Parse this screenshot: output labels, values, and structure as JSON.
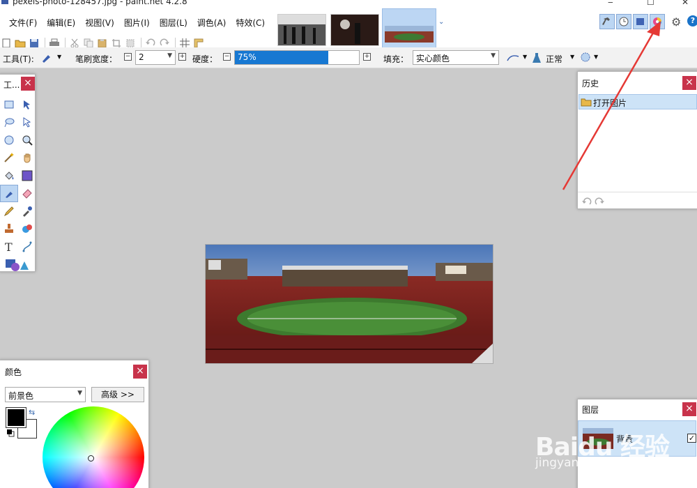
{
  "window": {
    "title": "pexels-photo-128457.jpg - paint.net 4.2.8"
  },
  "menu": [
    "文件(F)",
    "编辑(E)",
    "视图(V)",
    "图片(I)",
    "图层(L)",
    "调色(A)",
    "特效(C)"
  ],
  "toolbar": {
    "tool_label": "工具(T):",
    "brush_width_label": "笔刷宽度：",
    "brush_width_value": "2",
    "hardness_label": "硬度：",
    "hardness_value": "75%",
    "hardness_fraction": 0.75,
    "fill_label": "填充：",
    "fill_value": "实心颜色",
    "blend_mode": "正常"
  },
  "tools_panel": {
    "title": "工...",
    "close": "×"
  },
  "history_panel": {
    "title": "历史",
    "close": "×",
    "items": [
      "打开图片"
    ]
  },
  "colors_panel": {
    "title": "颜色",
    "close": "×",
    "mode_select": "前景色",
    "advanced_button": "高级 >>"
  },
  "layers_panel": {
    "title": "图层",
    "close": "×",
    "layer_name": "背景"
  },
  "watermark": {
    "main": "Baidu 经验",
    "sub": "jingyan.baidu.com"
  },
  "colors": {
    "accent": "#1778d2",
    "close_red": "#c8334b",
    "selection": "#cde3f7",
    "annotation_arrow": "#e53935"
  }
}
